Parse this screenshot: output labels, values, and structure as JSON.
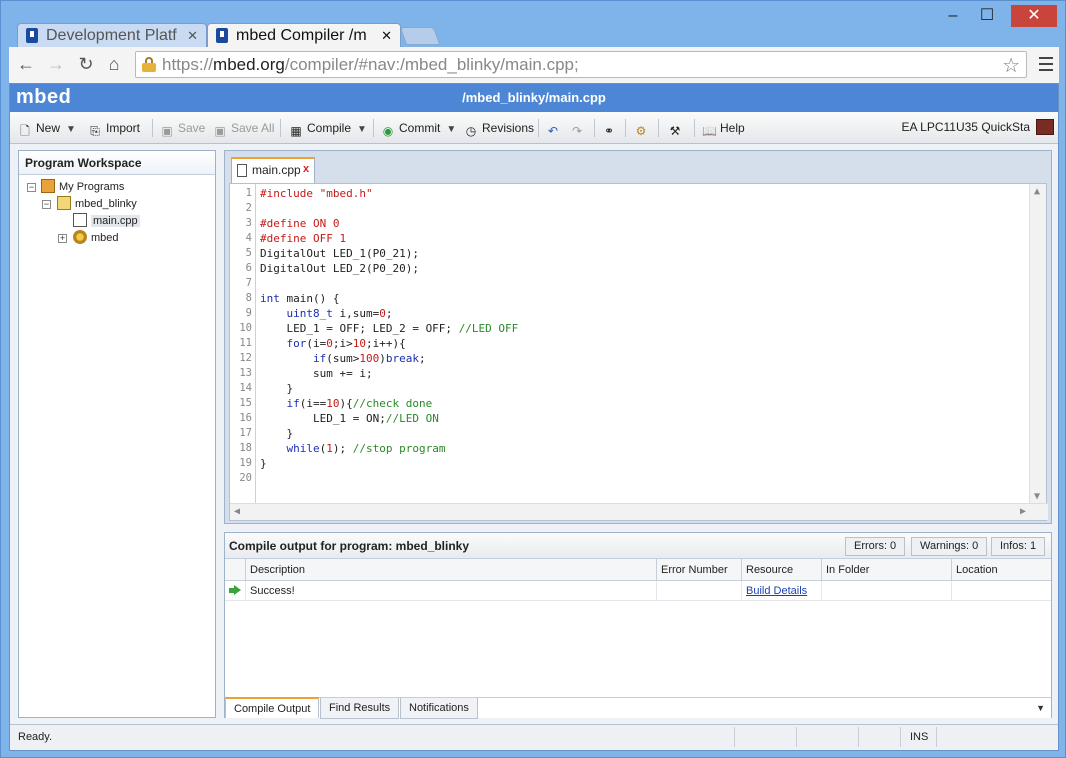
{
  "browser": {
    "tabs": [
      {
        "title": "Development Platf",
        "active": false
      },
      {
        "title": "mbed Compiler /m",
        "active": true
      }
    ],
    "url_scheme": "https://",
    "url_host": "mbed.org",
    "url_path": "/compiler/#nav:/mbed_blinky/main.cpp;",
    "window_controls": {
      "minimize": "–",
      "maximize": "☐",
      "close": "✕"
    }
  },
  "app": {
    "logo": "mbed",
    "path_title": "/mbed_blinky/main.cpp",
    "toolbar": {
      "new": "New",
      "import": "Import",
      "save": "Save",
      "save_all": "Save All",
      "compile": "Compile",
      "commit": "Commit",
      "revisions": "Revisions",
      "help": "Help",
      "target": "EA LPC11U35 QuickSta"
    },
    "workspace": {
      "title": "Program Workspace",
      "root": "My Programs",
      "project": "mbed_blinky",
      "file": "main.cpp",
      "library": "mbed"
    },
    "editor": {
      "tab": "main.cpp",
      "lines": [
        "#include \"mbed.h\"",
        "",
        "#define ON 0",
        "#define OFF 1",
        "DigitalOut LED_1(P0_21);",
        "DigitalOut LED_2(P0_20);",
        "",
        "int main() {",
        "    uint8_t i,sum=0;",
        "    LED_1 = OFF; LED_2 = OFF; //LED OFF",
        "    for(i=0;i>10;i++){",
        "        if(sum>100)break;",
        "        sum += i;",
        "    }",
        "    if(i==10){//check done",
        "        LED_1 = ON;//LED ON",
        "    }",
        "    while(1); //stop program",
        "}",
        ""
      ]
    },
    "output": {
      "title": "Compile output for program: mbed_blinky",
      "errors": "Errors: 0",
      "warnings": "Warnings: 0",
      "infos": "Infos: 1",
      "columns": [
        "Description",
        "Error Number",
        "Resource",
        "In Folder",
        "Location"
      ],
      "rows": [
        {
          "description": "Success!",
          "error_number": "",
          "resource": "Build Details",
          "in_folder": "",
          "location": ""
        }
      ],
      "tabs": [
        "Compile Output",
        "Find Results",
        "Notifications"
      ]
    },
    "status": {
      "text": "Ready.",
      "mode": "INS"
    }
  }
}
